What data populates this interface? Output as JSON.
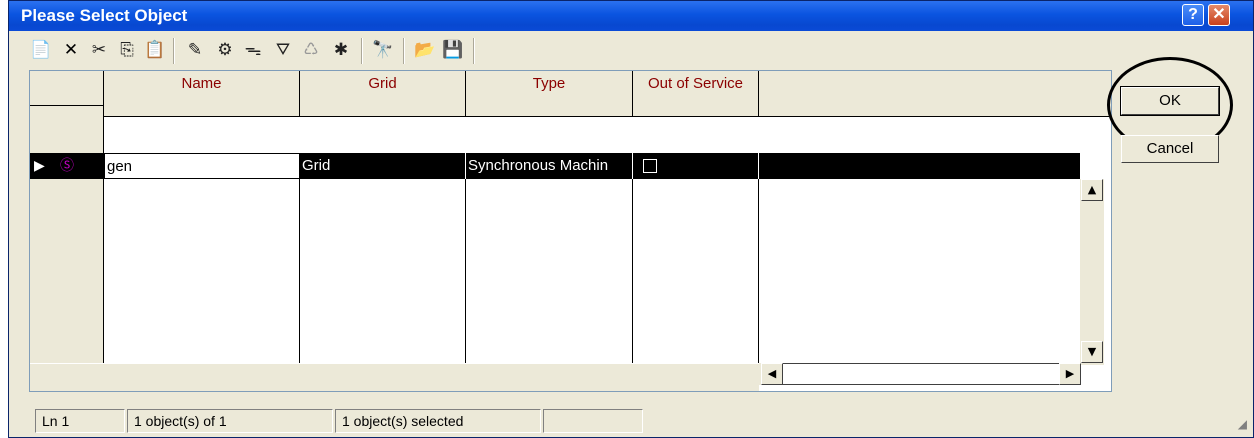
{
  "window": {
    "title": "Please Select Object"
  },
  "titlebar_buttons": {
    "help": "?",
    "close": "✕"
  },
  "toolbar": [
    {
      "name": "new-object-icon",
      "glyph": "📄"
    },
    {
      "name": "delete-icon",
      "glyph": "✕"
    },
    {
      "name": "cut-icon",
      "glyph": "✂"
    },
    {
      "name": "copy-icon",
      "glyph": "⎘"
    },
    {
      "name": "paste-icon",
      "glyph": "📋"
    },
    {
      "name": "edit-object-icon",
      "glyph": "✎"
    },
    {
      "name": "detail-icon",
      "glyph": "⚙"
    },
    {
      "name": "view-icon",
      "glyph": "ᯓ"
    },
    {
      "name": "filter-icon",
      "glyph": "⛛"
    },
    {
      "name": "graph-icon",
      "glyph": "♺"
    },
    {
      "name": "new-icon",
      "glyph": "✱"
    },
    {
      "name": "find-icon",
      "glyph": "🔭"
    },
    {
      "name": "open-folder-icon",
      "glyph": "📂"
    },
    {
      "name": "save-icon",
      "glyph": "💾"
    }
  ],
  "table": {
    "columns": [
      "Name",
      "Grid",
      "Type",
      "Out of Service"
    ],
    "rows": [
      {
        "name": "gen",
        "grid": "Grid",
        "type": "Synchronous Machin",
        "out_of_service": false
      }
    ],
    "row_marker": "▶",
    "row_icon": "Ⓢ"
  },
  "buttons": {
    "ok": "OK",
    "cancel": "Cancel"
  },
  "scroll": {
    "up": "▲",
    "down": "▼",
    "left": "◀",
    "right": "▶"
  },
  "statusbar": {
    "line": "Ln 1",
    "count": "1 object(s) of 1",
    "selected": "1 object(s) selected",
    "extra": ""
  },
  "colors": {
    "title_gradient": "#0a54e0",
    "header_text": "#8b0000",
    "row_selected_bg": "#000000"
  }
}
